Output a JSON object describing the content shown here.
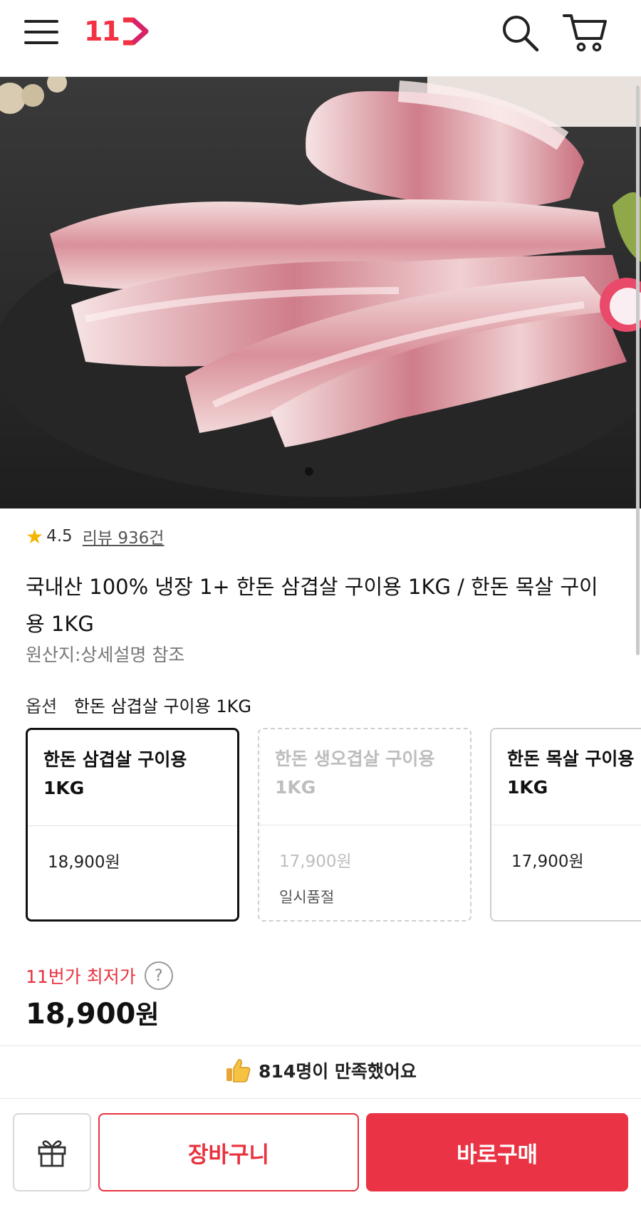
{
  "header": {
    "logo_text": "11",
    "brand_color": "#f43142"
  },
  "product": {
    "rating_score": "4.5",
    "review_text": "리뷰 936건",
    "title": "국내산 100% 냉장 1+ 한돈 삼겹살 구이용 1KG / 한돈 목살 구이용 1KG",
    "origin": "원산지:상세설명 참조",
    "image_count": 1,
    "current_image": 1
  },
  "option": {
    "label": "옵션",
    "selected": "한돈 삼겹살 구이용 1KG",
    "cards": [
      {
        "name": "한돈 삼겹살 구이용 1KG",
        "price": "18,900원",
        "status": "",
        "state": "selected"
      },
      {
        "name": "한돈 생오겹살 구이용 1KG",
        "price": "17,900원",
        "status": "일시품절",
        "state": "soldout"
      },
      {
        "name": "한돈 목살 구이용 1KG",
        "price": "17,900원",
        "status": "",
        "state": "normal"
      }
    ]
  },
  "pricing": {
    "lowest_label": "11번가 최저가",
    "help_glyph": "?",
    "price_number": "18,900",
    "price_unit": "원"
  },
  "satisfaction": {
    "text": "814명이 만족했어요"
  },
  "bottom": {
    "cart_label": "장바구니",
    "buy_label": "바로구매",
    "accent": "#ea3344"
  }
}
